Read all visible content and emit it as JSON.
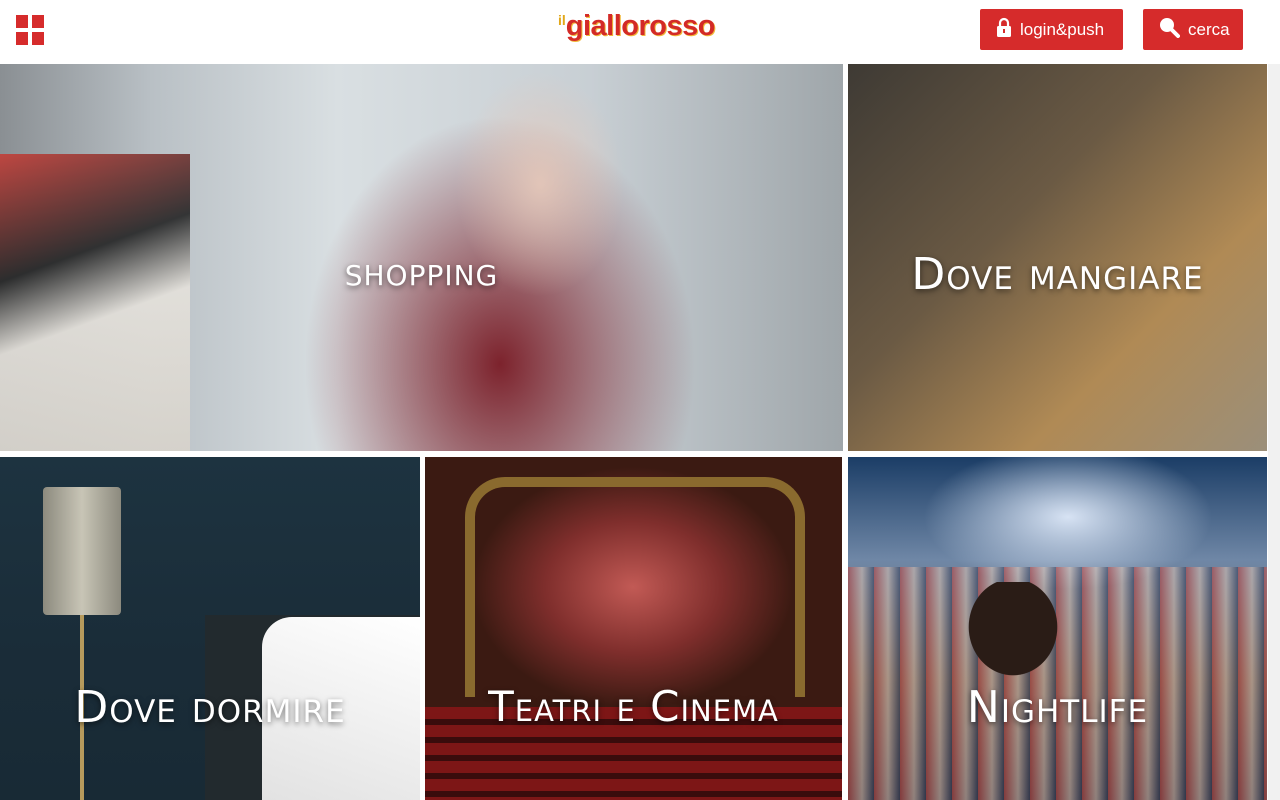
{
  "header": {
    "logo_prefix": "il",
    "logo_main": "giallorosso",
    "login_label": "login&push",
    "search_label": "cerca",
    "menu_icon": "grid-menu-icon",
    "login_icon": "lock-icon",
    "search_icon": "search-icon"
  },
  "colors": {
    "accent": "#d62b2b",
    "logo_yellow": "#e2a81a"
  },
  "tiles": [
    {
      "label": "shopping"
    },
    {
      "label": "Dove mangiare"
    },
    {
      "label": "Dove dormire"
    },
    {
      "label": "Teatri e Cinema"
    },
    {
      "label": "Nightlife"
    }
  ]
}
